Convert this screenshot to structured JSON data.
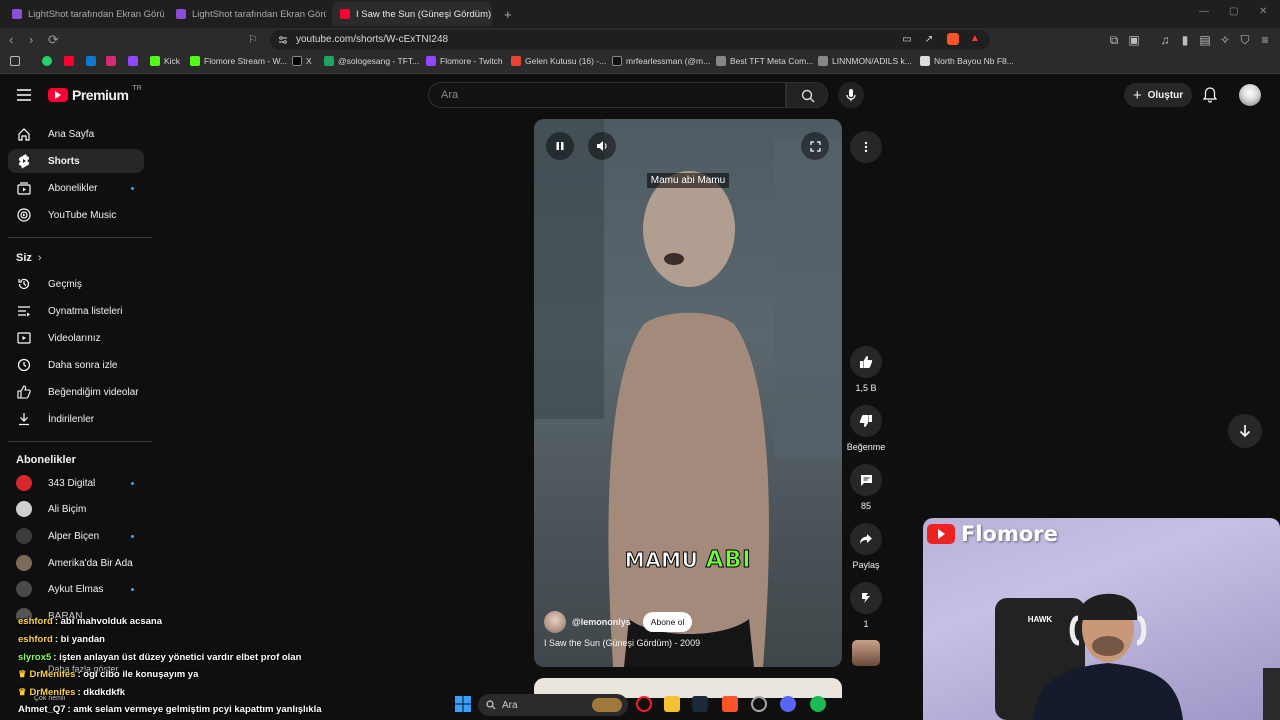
{
  "browser": {
    "tabs": [
      {
        "label": "LightShot tarafından Ekran Görüntüsü"
      },
      {
        "label": "LightShot tarafından Ekran Görüntüsü"
      },
      {
        "label": "I Saw the Sun (Güneşi Gördüm)"
      }
    ],
    "url": "youtube.com/shorts/W-cExTNI248",
    "bookmarks": [
      "Kick",
      "Flomore Stream - W...",
      "X",
      "@sologesang - TFT...",
      "Flomore - Twitch",
      "Gelen Kutusu (16) -...",
      "mrfearlessman (@m...",
      "Best TFT Meta Com...",
      "LINNMON/ADILS k...",
      "North Bayou Nb F8..."
    ]
  },
  "header": {
    "logo_text": "Premium",
    "region": "TR",
    "search_placeholder": "Ara",
    "create_label": "Oluştur"
  },
  "sidebar": {
    "main": [
      {
        "label": "Ana Sayfa",
        "icon": "home-icon"
      },
      {
        "label": "Shorts",
        "icon": "shorts-icon"
      },
      {
        "label": "Abonelikler",
        "icon": "subscriptions-icon"
      },
      {
        "label": "YouTube Music",
        "icon": "youtube-music-icon"
      }
    ],
    "you_heading": "Siz",
    "you": [
      {
        "label": "Geçmiş",
        "icon": "history-icon"
      },
      {
        "label": "Oynatma listeleri",
        "icon": "playlists-icon"
      },
      {
        "label": "Videolarınız",
        "icon": "your-videos-icon"
      },
      {
        "label": "Daha sonra izle",
        "icon": "watch-later-icon"
      },
      {
        "label": "Beğendiğim videolar",
        "icon": "liked-videos-icon"
      },
      {
        "label": "İndirilenler",
        "icon": "downloads-icon"
      }
    ],
    "subs_heading": "Abonelikler",
    "subscriptions": [
      {
        "label": "343 Digital",
        "color": "#d8262c"
      },
      {
        "label": "Ali Biçim",
        "color": "#cfcfcf"
      },
      {
        "label": "Alper Biçen",
        "color": "#3b3b3b"
      },
      {
        "label": "Amerika'da Bir Ada",
        "color": "#7a6a5a"
      },
      {
        "label": "Aykut Elmas",
        "color": "#4a4a4a"
      },
      {
        "label": "BARAN",
        "color": "#555555"
      }
    ],
    "show_more": "Daha fazla göster",
    "see_more": "Çok nemli"
  },
  "video": {
    "caption_top": "Mamu abi Mamu",
    "subtitle_word1": "MAMU",
    "subtitle_word2": "ABI",
    "channel": "@lemononlys",
    "subscribe_label": "Abone ol",
    "title": "I Saw the Sun (Güneşi Gördüm) - 2009"
  },
  "actions": {
    "like_count": "1,5 B",
    "dislike_label": "Beğenme",
    "comment_count": "85",
    "share_label": "Paylaş",
    "remix_count": "1"
  },
  "chat": [
    {
      "user": "eshford",
      "msg": ": abi mahvolduk acsana",
      "color": "#ffd24a"
    },
    {
      "user": "eshford",
      "msg": ": bi yandan",
      "color": "#ffd24a"
    },
    {
      "user": "slyrox5",
      "msg": ": işten anlayan üst düzey yönetici vardır elbet prof olan",
      "color": "#8bff5a"
    },
    {
      "user": "DrMenifes",
      "msg": ": ogi cibo ile konuşayım ya",
      "color": "#ffd24a"
    },
    {
      "user": "DrMenifes",
      "msg": ": dkdkdkfk",
      "color": "#ffd24a"
    },
    {
      "user": "Ahmet_Q7",
      "msg": ": amk selam vermeye gelmiştim pcyi kapattım yanlışlıkla",
      "color": "#ffffff"
    }
  ],
  "webcam": {
    "brand": "Flomore"
  },
  "taskbar": {
    "search_label": "Ara"
  },
  "colors": {
    "brand_red": "#ff0033",
    "accent_blue": "#3ea6ff",
    "subtitle_green": "#6cff3a"
  }
}
